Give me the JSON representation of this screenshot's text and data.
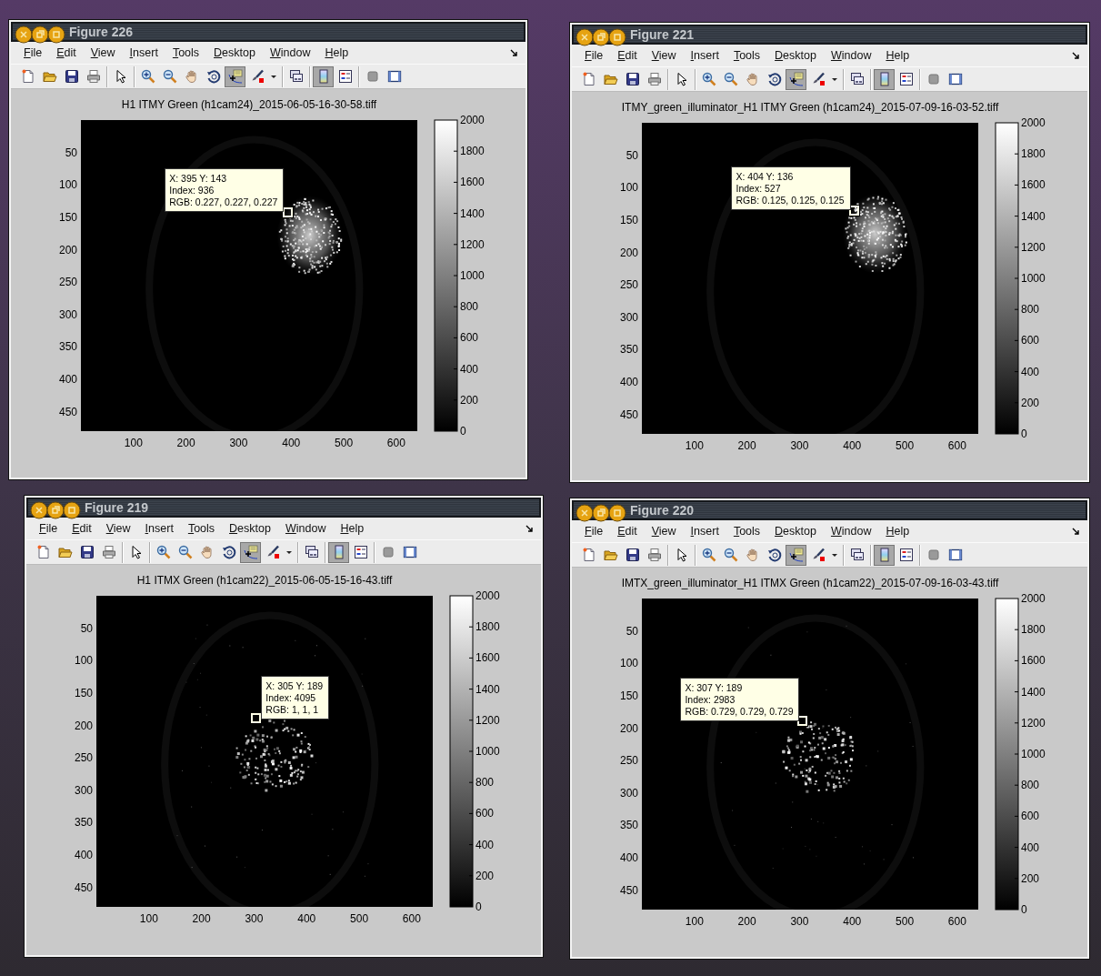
{
  "windows": [
    {
      "title": "Figure 226",
      "menu": [
        "File",
        "Edit",
        "View",
        "Insert",
        "Tools",
        "Desktop",
        "Window",
        "Help"
      ],
      "toolbar": [
        [
          {
            "kind": "new",
            "on": false
          },
          {
            "kind": "open",
            "on": false
          },
          {
            "kind": "save",
            "on": false
          },
          {
            "kind": "print",
            "on": false
          }
        ],
        [
          {
            "kind": "pointer",
            "on": false
          }
        ],
        [
          {
            "kind": "zoom-in",
            "on": false
          },
          {
            "kind": "zoom-out",
            "on": false
          },
          {
            "kind": "pan",
            "on": false
          },
          {
            "kind": "rotate",
            "on": false
          },
          {
            "kind": "datatip",
            "on": true
          },
          {
            "kind": "brush",
            "on": false
          },
          {
            "kind": "caret",
            "on": false
          }
        ],
        [
          {
            "kind": "link",
            "on": false
          }
        ],
        [
          {
            "kind": "colorbar",
            "on": true
          },
          {
            "kind": "legend",
            "on": false
          }
        ],
        [
          {
            "kind": "hide",
            "on": false
          },
          {
            "kind": "plotwin",
            "on": false
          }
        ]
      ],
      "figure": {
        "title": "H1 ITMY Green (h1cam24)_2015-06-05-16-30-58.tiff",
        "yticks": [
          "50",
          "100",
          "150",
          "200",
          "250",
          "300",
          "350",
          "400",
          "450"
        ],
        "xticks": [
          "100",
          "200",
          "300",
          "400",
          "500",
          "600"
        ],
        "colorbar_ticks": [
          "2000",
          "1800",
          "1600",
          "1400",
          "1200",
          "1000",
          "800",
          "600",
          "400",
          "200",
          "0"
        ],
        "datatip": [
          "X: 395 Y: 143",
          "Index: 936",
          "RGB: 0.227, 0.227, 0.227"
        ]
      }
    },
    {
      "title": "Figure 221",
      "menu": [
        "File",
        "Edit",
        "View",
        "Insert",
        "Tools",
        "Desktop",
        "Window",
        "Help"
      ],
      "toolbar": [
        [
          {
            "kind": "new",
            "on": false
          },
          {
            "kind": "open",
            "on": false
          },
          {
            "kind": "save",
            "on": false
          },
          {
            "kind": "print",
            "on": false
          }
        ],
        [
          {
            "kind": "pointer",
            "on": false
          }
        ],
        [
          {
            "kind": "zoom-in",
            "on": false
          },
          {
            "kind": "zoom-out",
            "on": false
          },
          {
            "kind": "pan",
            "on": false
          },
          {
            "kind": "rotate",
            "on": false
          },
          {
            "kind": "datatip",
            "on": true
          },
          {
            "kind": "brush",
            "on": false
          },
          {
            "kind": "caret",
            "on": false
          }
        ],
        [
          {
            "kind": "link",
            "on": false
          }
        ],
        [
          {
            "kind": "colorbar",
            "on": true
          },
          {
            "kind": "legend",
            "on": false
          }
        ],
        [
          {
            "kind": "hide",
            "on": false
          },
          {
            "kind": "plotwin",
            "on": false
          }
        ]
      ],
      "figure": {
        "title": "ITMY_green_illuminator_H1 ITMY Green (h1cam24)_2015-07-09-16-03-52.tiff",
        "yticks": [
          "50",
          "100",
          "150",
          "200",
          "250",
          "300",
          "350",
          "400",
          "450"
        ],
        "xticks": [
          "100",
          "200",
          "300",
          "400",
          "500",
          "600"
        ],
        "colorbar_ticks": [
          "2000",
          "1800",
          "1600",
          "1400",
          "1200",
          "1000",
          "800",
          "600",
          "400",
          "200",
          "0"
        ],
        "datatip": [
          "X: 404 Y: 136",
          "Index: 527",
          "RGB: 0.125, 0.125, 0.125"
        ]
      }
    },
    {
      "title": "Figure 219",
      "menu": [
        "File",
        "Edit",
        "View",
        "Insert",
        "Tools",
        "Desktop",
        "Window",
        "Help"
      ],
      "toolbar": [
        [
          {
            "kind": "new",
            "on": false
          },
          {
            "kind": "open",
            "on": false
          },
          {
            "kind": "save",
            "on": false
          },
          {
            "kind": "print",
            "on": false
          }
        ],
        [
          {
            "kind": "pointer",
            "on": false
          }
        ],
        [
          {
            "kind": "zoom-in",
            "on": false
          },
          {
            "kind": "zoom-out",
            "on": false
          },
          {
            "kind": "pan",
            "on": false
          },
          {
            "kind": "rotate",
            "on": false
          },
          {
            "kind": "datatip",
            "on": true
          },
          {
            "kind": "brush",
            "on": false
          },
          {
            "kind": "caret",
            "on": false
          }
        ],
        [
          {
            "kind": "link",
            "on": false
          }
        ],
        [
          {
            "kind": "colorbar",
            "on": true
          },
          {
            "kind": "legend",
            "on": false
          }
        ],
        [
          {
            "kind": "hide",
            "on": false
          },
          {
            "kind": "plotwin",
            "on": false
          }
        ]
      ],
      "figure": {
        "title": "H1 ITMX Green (h1cam22)_2015-06-05-15-16-43.tiff",
        "yticks": [
          "50",
          "100",
          "150",
          "200",
          "250",
          "300",
          "350",
          "400",
          "450"
        ],
        "xticks": [
          "100",
          "200",
          "300",
          "400",
          "500",
          "600"
        ],
        "colorbar_ticks": [
          "2000",
          "1800",
          "1600",
          "1400",
          "1200",
          "1000",
          "800",
          "600",
          "400",
          "200",
          "0"
        ],
        "datatip": [
          "X: 305 Y: 189",
          "Index: 4095",
          "RGB: 1, 1, 1"
        ]
      }
    },
    {
      "title": "Figure 220",
      "menu": [
        "File",
        "Edit",
        "View",
        "Insert",
        "Tools",
        "Desktop",
        "Window",
        "Help"
      ],
      "toolbar": [
        [
          {
            "kind": "new",
            "on": false
          },
          {
            "kind": "open",
            "on": false
          },
          {
            "kind": "save",
            "on": false
          },
          {
            "kind": "print",
            "on": false
          }
        ],
        [
          {
            "kind": "pointer",
            "on": false
          }
        ],
        [
          {
            "kind": "zoom-in",
            "on": false
          },
          {
            "kind": "zoom-out",
            "on": false
          },
          {
            "kind": "pan",
            "on": false
          },
          {
            "kind": "rotate",
            "on": false
          },
          {
            "kind": "datatip",
            "on": true
          },
          {
            "kind": "brush",
            "on": false
          },
          {
            "kind": "caret",
            "on": false
          }
        ],
        [
          {
            "kind": "link",
            "on": false
          }
        ],
        [
          {
            "kind": "colorbar",
            "on": true
          },
          {
            "kind": "legend",
            "on": false
          }
        ],
        [
          {
            "kind": "hide",
            "on": false
          },
          {
            "kind": "plotwin",
            "on": false
          }
        ]
      ],
      "figure": {
        "title": "IMTX_green_illuminator_H1 ITMX Green (h1cam22)_2015-07-09-16-03-43.tiff",
        "yticks": [
          "50",
          "100",
          "150",
          "200",
          "250",
          "300",
          "350",
          "400",
          "450"
        ],
        "xticks": [
          "100",
          "200",
          "300",
          "400",
          "500",
          "600"
        ],
        "colorbar_ticks": [
          "2000",
          "1800",
          "1600",
          "1400",
          "1200",
          "1000",
          "800",
          "600",
          "400",
          "200",
          "0"
        ],
        "datatip": [
          "X: 307 Y: 189",
          "Index: 2983",
          "RGB: 0.729, 0.729, 0.729"
        ]
      }
    }
  ]
}
